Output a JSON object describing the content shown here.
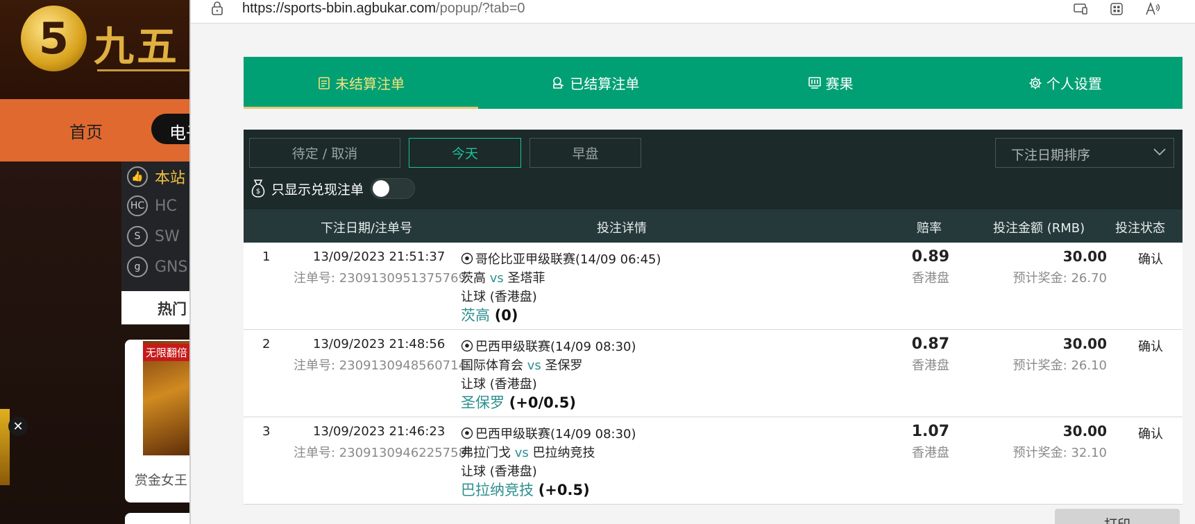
{
  "background_site": {
    "logo_text": "九五",
    "logo_badge": "5",
    "nav_home": "首页",
    "nav_active": "电子",
    "menu_items": [
      {
        "label": "本站",
        "icon": "thumb-up-icon",
        "icon_text": "👍"
      },
      {
        "label": "HC",
        "icon": "hc-logo-icon",
        "icon_text": "HC"
      },
      {
        "label": "SW",
        "icon": "sw-logo-icon",
        "icon_text": "S"
      },
      {
        "label": "GNS",
        "icon": "gns-logo-icon",
        "icon_text": "g"
      }
    ],
    "hot_label": "热门",
    "card_tag": "无限翻倍",
    "card_title": "赏金女王",
    "close_glyph": "✕"
  },
  "browser": {
    "url_host": "https://sports-bbin.agbukar.com",
    "url_path": "/popup/?tab=0"
  },
  "tabs": [
    {
      "label": "未结算注单",
      "icon": "bet-slip-icon",
      "active": true
    },
    {
      "label": "已结算注单",
      "icon": "settled-coins-icon",
      "active": false
    },
    {
      "label": "赛果",
      "icon": "scoreboard-icon",
      "active": false
    },
    {
      "label": "个人设置",
      "icon": "gear-icon",
      "active": false
    }
  ],
  "filters": {
    "buttons": [
      {
        "label": "待定 / 取消",
        "active": false
      },
      {
        "label": "今天",
        "active": true
      },
      {
        "label": "早盘",
        "active": false
      }
    ],
    "sort_label": "下注日期排序",
    "cashout_label": "只显示兑现注单",
    "cashout_on": false
  },
  "table": {
    "headers": {
      "date": "下注日期/注单号",
      "detail": "投注详情",
      "odds": "赔率",
      "amount": "投注金额 (RMB)",
      "status": "投注状态"
    },
    "rows": [
      {
        "index": "1",
        "datetime": "13/09/2023 21:51:37",
        "order": "注单号: 2309130951375769",
        "league": "哥伦比亚甲级联赛(14/09 06:45)",
        "home": "茨高",
        "vs": "vs",
        "away": "圣塔菲",
        "market": "让球 (香港盘)",
        "pick_team": "茨高",
        "pick_hdp": "(0)",
        "odds": "0.89",
        "odds_type": "香港盘",
        "amount": "30.00",
        "est_win": "预计奖金: 26.70",
        "status": "确认"
      },
      {
        "index": "2",
        "datetime": "13/09/2023 21:48:56",
        "order": "注单号: 2309130948560714",
        "league": "巴西甲级联赛(14/09 08:30)",
        "home": "国际体育会",
        "vs": "vs",
        "away": "圣保罗",
        "market": "让球 (香港盘)",
        "pick_team": "圣保罗",
        "pick_hdp": "(+0/0.5)",
        "odds": "0.87",
        "odds_type": "香港盘",
        "amount": "30.00",
        "est_win": "预计奖金: 26.10",
        "status": "确认"
      },
      {
        "index": "3",
        "datetime": "13/09/2023 21:46:23",
        "order": "注单号: 2309130946225758",
        "league": "巴西甲级联赛(14/09 08:30)",
        "home": "弗拉门戈",
        "vs": "vs",
        "away": "巴拉纳竞技",
        "market": "让球 (香港盘)",
        "pick_team": "巴拉纳竞技",
        "pick_hdp": "(+0.5)",
        "odds": "1.07",
        "odds_type": "香港盘",
        "amount": "30.00",
        "est_win": "预计奖金: 32.10",
        "status": "确认"
      }
    ]
  },
  "print_label": "打印",
  "colors": {
    "tab_bg": "#01a074",
    "tab_active_text": "#f7e27a",
    "filter_bg": "#1d2a2a",
    "table_head_bg": "#26393a",
    "accent_teal": "#1ac49a",
    "team_color": "#2e8f8f"
  }
}
